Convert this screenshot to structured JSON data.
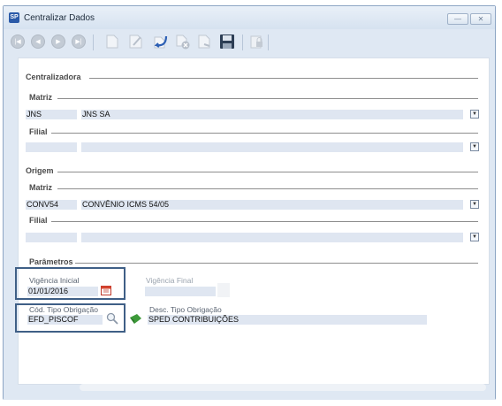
{
  "window": {
    "title": "Centralizar Dados",
    "app_icon": "SP"
  },
  "window_controls": {
    "minimize": "—",
    "close": "✕"
  },
  "sections": {
    "centralizadora": "Centralizadora",
    "origem": "Origem",
    "parametros": "Parâmetros"
  },
  "centralizadora": {
    "matriz_label": "Matriz",
    "matriz_code": "JNS",
    "matriz_name": "JNS SA",
    "filial_label": "Filial",
    "filial_code": "",
    "filial_name": ""
  },
  "origem": {
    "matriz_label": "Matriz",
    "matriz_code": "CONV54",
    "matriz_name": "CONVÊNIO ICMS 54/05",
    "filial_label": "Filial",
    "filial_code": "",
    "filial_name": ""
  },
  "parametros": {
    "vigencia_inicial_label": "Vigência Inicial",
    "vigencia_inicial_value": "01/01/2016",
    "vigencia_final_label": "Vigência Final",
    "vigencia_final_value": "",
    "cod_tipo_obrigacao_label": "Cód. Tipo Obrigação",
    "cod_tipo_obrigacao_value": "EFD_PISCOF",
    "desc_tipo_obrigacao_label": "Desc. Tipo Obrigação",
    "desc_tipo_obrigacao_value": "SPED CONTRIBUIÇÕES"
  },
  "dropdown_glyph": "▼",
  "icons": [
    "first-icon",
    "previous-icon",
    "next-icon",
    "last-icon",
    "new-icon",
    "edit-icon",
    "confirm-icon",
    "cancel-icon",
    "delete-icon",
    "save-icon",
    "lock-icon",
    "calendar-icon",
    "search-icon",
    "arrow-icon"
  ]
}
